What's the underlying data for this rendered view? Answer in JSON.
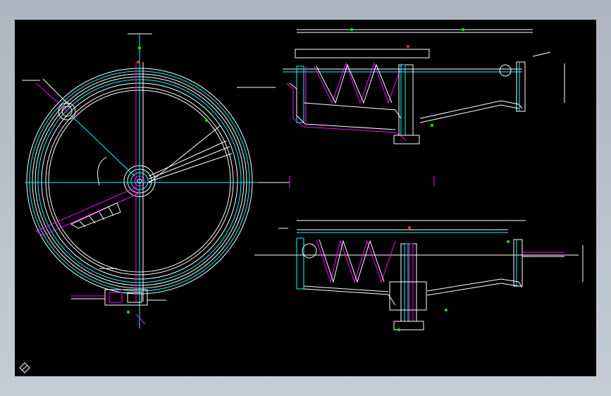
{
  "colors": {
    "background": "#000000",
    "frame": "#b9c0cc",
    "line_white": "#ffffff",
    "line_cyan": "#00ffff",
    "line_magenta": "#ff00ff",
    "line_green": "#00ff00",
    "line_red": "#ff3030"
  },
  "views": {
    "plan_title": "",
    "section_a_title": "",
    "section_b_title": ""
  },
  "icons": {
    "ucs": "ucs-icon"
  }
}
